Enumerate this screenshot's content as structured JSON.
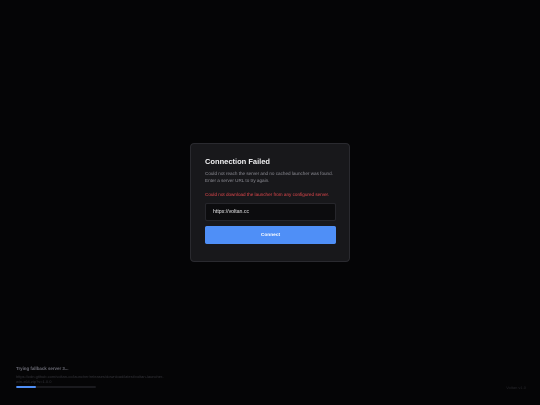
{
  "dialog": {
    "title": "Connection Failed",
    "message": "Could not reach the server and no cached launcher was found. Enter a server URL to try again.",
    "error": "Could not download the launcher from any configured server.",
    "server_input_value": "https://voltan.cc",
    "connect_label": "Connect"
  },
  "status": {
    "title": "Trying fallback server 3...",
    "detail": "https://cdn.github.com/voltan-cc/launcher/releases/download/latest/voltan-launcher-win-x64.zip?v=1.0.0",
    "progress_fraction": 0.25,
    "version": "Voltan v1.0"
  },
  "colors": {
    "accent": "#4f8ff7",
    "error": "#e5484d",
    "background": "#050506",
    "dialog_background": "#18181b"
  }
}
